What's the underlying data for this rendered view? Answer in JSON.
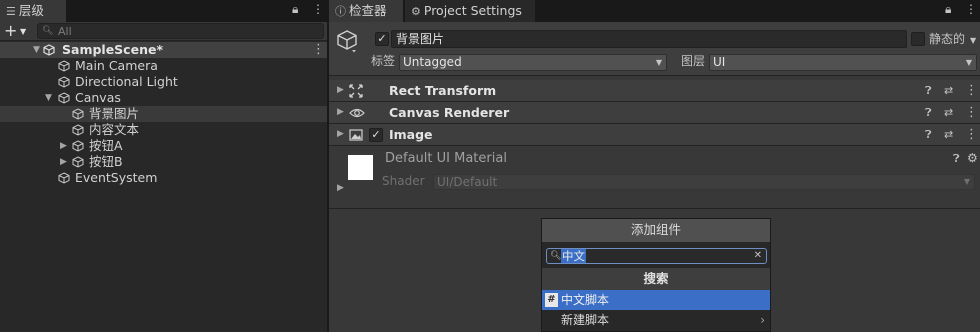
{
  "hierarchy": {
    "tab_label": "层级",
    "search_placeholder": "All",
    "scene_name": "SampleScene*",
    "items": [
      {
        "label": "Main Camera"
      },
      {
        "label": "Directional Light"
      },
      {
        "label": "Canvas"
      },
      {
        "label": "背景图片"
      },
      {
        "label": "内容文本"
      },
      {
        "label": "按钮A"
      },
      {
        "label": "按钮B"
      },
      {
        "label": "EventSystem"
      }
    ]
  },
  "inspector": {
    "tabs": [
      {
        "label": "检查器",
        "icon": "info-icon"
      },
      {
        "label": "Project Settings",
        "icon": "gear-icon"
      }
    ],
    "object_name": "背景图片",
    "static_label": "静态的",
    "tag_label": "标签",
    "tag_value": "Untagged",
    "layer_label": "图层",
    "layer_value": "UI",
    "components": [
      {
        "title": "Rect Transform",
        "icon": "rect-transform-icon"
      },
      {
        "title": "Canvas Renderer",
        "icon": "eye-icon"
      },
      {
        "title": "Image",
        "icon": "image-icon"
      }
    ],
    "material": {
      "name": "Default UI Material",
      "shader_label": "Shader",
      "shader_value": "UI/Default",
      "swatch_color": "#ffffff"
    }
  },
  "add_component": {
    "title": "添加组件",
    "search_query": "中文",
    "section_header": "搜索",
    "items": [
      {
        "label": "中文脚本",
        "highlighted": true
      },
      {
        "label": "新建脚本",
        "highlighted": false
      }
    ]
  },
  "colors": {
    "panel_bg": "#383838",
    "hierarchy_bg": "#282828",
    "selection": "#3b6ec6"
  }
}
